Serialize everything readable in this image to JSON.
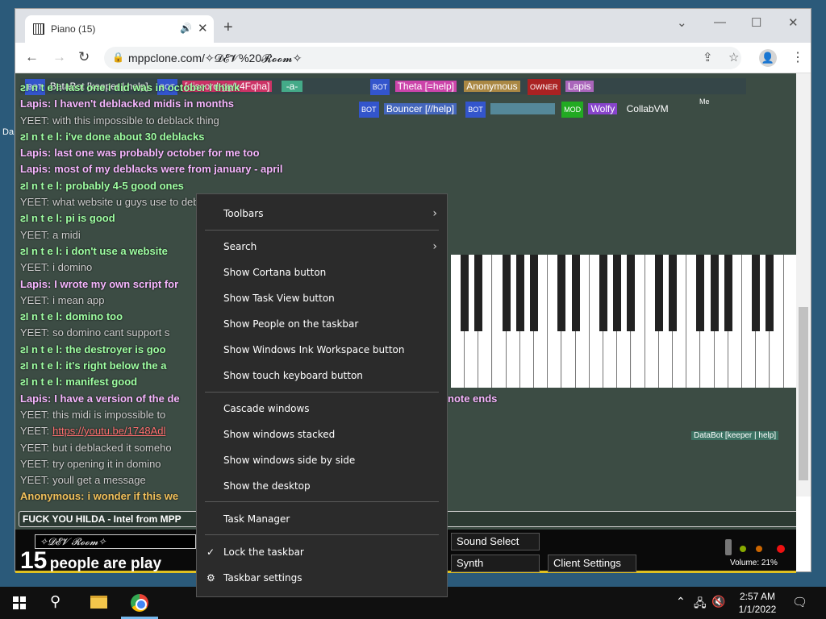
{
  "desktop": {
    "side_label": "Da"
  },
  "browser": {
    "tab": {
      "title": "Piano (15)",
      "audio_icon": "speaker-icon"
    },
    "url": "mppclone.com/✧𝓓𝓔𝓥%20𝓡𝓸𝓸𝓶✧"
  },
  "room_labels": {
    "row1": [
      "BOT",
      "BataBot [keeper | help]",
      "BOT",
      "[discord.gg/k4Fqha]",
      "-a-",
      "BOT",
      "Theta [=help]",
      "Anonymous",
      "OWNER",
      "Lapis"
    ],
    "row2": [
      "BOT",
      "Bouncer [//help]",
      "BOT",
      "MOD",
      "Wolfy",
      "CollabVM"
    ],
    "databot": "DataBot [keeper | help]",
    "me": "Me"
  },
  "chat": [
    {
      "name": "ꙅI n t e l:",
      "text": "last one i did was in october i think",
      "kind": "intel"
    },
    {
      "name": "Lapis:",
      "text": "I haven't deblacked midis in months",
      "kind": "lapis"
    },
    {
      "name": "YEET:",
      "text": "with this impossible to deblack thing",
      "kind": "yeet"
    },
    {
      "name": "ꙅI n t e l:",
      "text": "i've done about 30 deblacks",
      "kind": "intel"
    },
    {
      "name": "Lapis:",
      "text": "last one was probably october for me too",
      "kind": "lapis"
    },
    {
      "name": "Lapis:",
      "text": "most of my deblacks were from january - april",
      "kind": "lapis"
    },
    {
      "name": "ꙅI n t e l:",
      "text": "probably 4-5 good ones",
      "kind": "intel"
    },
    {
      "name": "YEET:",
      "text": "what website u guys use to deblack",
      "kind": "yeet"
    },
    {
      "name": "ꙅI n t e l:",
      "text": "pi is good",
      "kind": "intel"
    },
    {
      "name": "YEET:",
      "text": "a midi",
      "kind": "yeet"
    },
    {
      "name": "ꙅI n t e l:",
      "text": "i don't use a website",
      "kind": "intel"
    },
    {
      "name": "YEET:",
      "text": "i domino",
      "kind": "yeet"
    },
    {
      "name": "Lapis:",
      "text": "I wrote my own script for",
      "kind": "lapis"
    },
    {
      "name": "YEET:",
      "text": "i mean app",
      "kind": "yeet"
    },
    {
      "name": "ꙅI n t e l:",
      "text": "domino too",
      "kind": "intel"
    },
    {
      "name": "YEET:",
      "text": "so domino cant support s",
      "kind": "yeet"
    },
    {
      "name": "ꙅI n t e l:",
      "text": "the destroyer is goo",
      "kind": "intel"
    },
    {
      "name": "ꙅI n t e l:",
      "text": "it's right below the a",
      "kind": "intel"
    },
    {
      "name": "ꙅI n t e l:",
      "text": "manifest good",
      "kind": "intel"
    },
    {
      "name": "Lapis:",
      "text": "I have a version of the de",
      "kind": "lapis",
      "tail": "note ends"
    },
    {
      "name": "YEET:",
      "text": "this midi is impossible to",
      "kind": "yeet"
    },
    {
      "name": "YEET:",
      "text": "https://youtu.be/1748Adl",
      "kind": "yeet",
      "link": true
    },
    {
      "name": "YEET:",
      "text": "but i deblacked it someho",
      "kind": "yeet"
    },
    {
      "name": "YEET:",
      "text": "try opening it in domino",
      "kind": "yeet"
    },
    {
      "name": "YEET:",
      "text": "youll get a message",
      "kind": "yeet"
    },
    {
      "name": "Anonymous:",
      "text": "i wonder if this we",
      "kind": "anon"
    }
  ],
  "chat_input": "FUCK YOU HILDA - Intel from MPP",
  "bottom": {
    "room_name": "✧𝓓𝓔𝓥 𝓡𝓸𝓸𝓶✧",
    "count": "15",
    "count_text": "people are play",
    "sound_select": "Sound Select",
    "synth": "Synth",
    "client_settings": "Client Settings",
    "volume": "Volume: 21%"
  },
  "context_menu": {
    "items": [
      {
        "label": "Toolbars",
        "submenu": true
      },
      {
        "label": "Search",
        "submenu": true
      },
      {
        "label": "Show Cortana button"
      },
      {
        "label": "Show Task View button"
      },
      {
        "label": "Show People on the taskbar"
      },
      {
        "label": "Show Windows Ink Workspace button"
      },
      {
        "label": "Show touch keyboard button"
      },
      {
        "label": "Cascade windows"
      },
      {
        "label": "Show windows stacked"
      },
      {
        "label": "Show windows side by side"
      },
      {
        "label": "Show the desktop"
      },
      {
        "label": "Task Manager"
      },
      {
        "label": "Lock the taskbar",
        "checked": true
      },
      {
        "label": "Taskbar settings",
        "icon": "gear-icon"
      }
    ]
  },
  "taskbar": {
    "time": "2:57 AM",
    "date": "1/1/2022"
  }
}
